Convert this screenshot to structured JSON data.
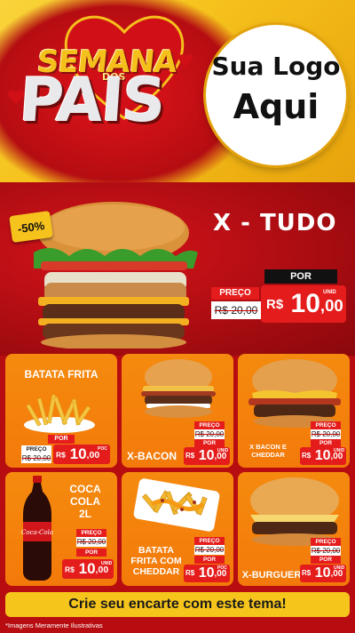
{
  "header": {
    "title_line1": "SEMANA",
    "title_small": "DOS",
    "title_line2": "PAIS",
    "logo_line1": "Sua Logo",
    "logo_line2": "Aqui"
  },
  "featured": {
    "discount_badge": "-50%",
    "name": "X - TUDO",
    "preco_label": "PREÇO",
    "old_price": "R$ 20,00",
    "por_label": "POR",
    "currency": "R$",
    "price_int": "10",
    "price_cents": ",00",
    "unit": "UNID"
  },
  "products": [
    {
      "name": "BATATA FRITA",
      "preco_label": "PREÇO",
      "old_price": "R$ 20,00",
      "por_label": "POR",
      "currency": "R$",
      "price_int": "10",
      "price_cents": ",00",
      "unit": "POC"
    },
    {
      "name": "X-BACON",
      "preco_label": "PREÇO",
      "old_price": "R$ 20,00",
      "por_label": "POR",
      "currency": "R$",
      "price_int": "10",
      "price_cents": ",00",
      "unit": "UNID"
    },
    {
      "name_line1": "X BACON E",
      "name_line2": "CHEDDAR",
      "preco_label": "PREÇO",
      "old_price": "R$ 20,00",
      "por_label": "POR",
      "currency": "R$",
      "price_int": "10",
      "price_cents": ",00",
      "unit": "UNID"
    },
    {
      "name_line1": "COCA",
      "name_line2": "COLA",
      "name_line3": "2L",
      "preco_label": "PREÇO",
      "old_price": "R$ 20,00",
      "por_label": "POR",
      "currency": "R$",
      "price_int": "10",
      "price_cents": ",00",
      "unit": "UNID"
    },
    {
      "name_line1": "BATATA",
      "name_line2": "FRITA COM",
      "name_line3": "CHEDDAR",
      "preco_label": "PREÇO",
      "old_price": "R$ 20,00",
      "por_label": "POR",
      "currency": "R$",
      "price_int": "10",
      "price_cents": ",00",
      "unit": "POC"
    },
    {
      "name": "X-BURGUER",
      "preco_label": "PREÇO",
      "old_price": "R$ 20,00",
      "por_label": "POR",
      "currency": "R$",
      "price_int": "10",
      "price_cents": ",00",
      "unit": "UNID"
    }
  ],
  "footer": {
    "cta": "Crie seu encarte com este tema!",
    "disclaimer": "*Imagens Meramente Ilustrativas"
  },
  "colors": {
    "brand_red": "#e51c1c",
    "brand_yellow": "#f6c21c",
    "card_orange": "#f58a0e"
  },
  "icons": {
    "coca_cola_logo": "Coca-Cola"
  }
}
